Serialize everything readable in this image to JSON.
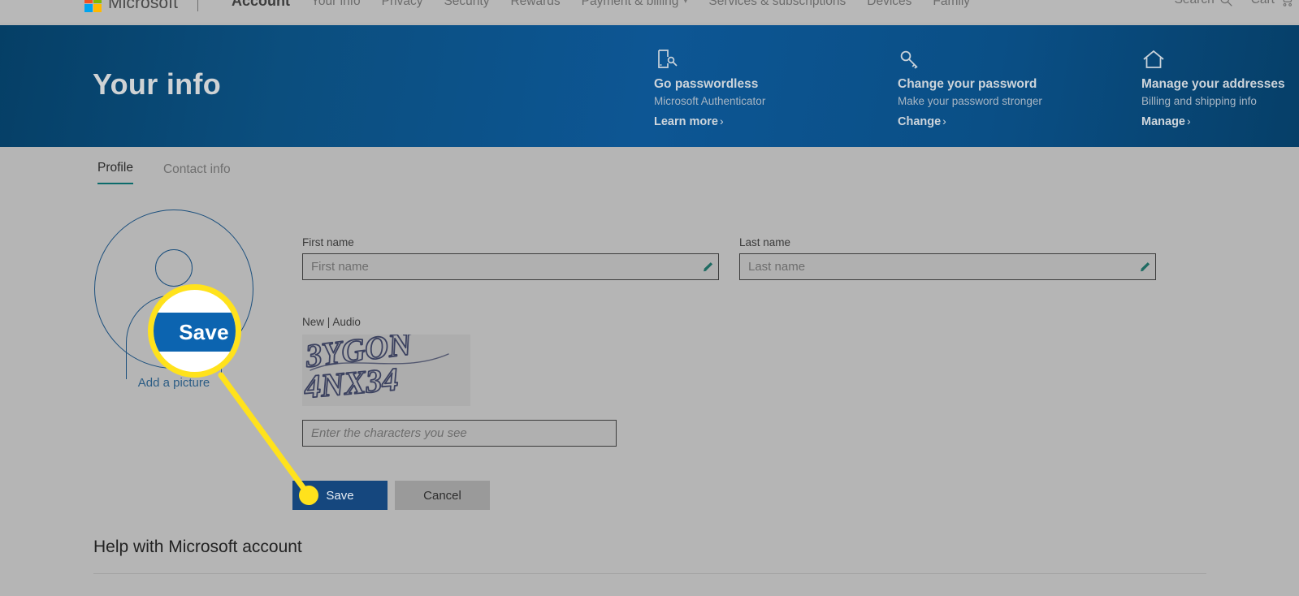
{
  "topnav": {
    "brand": "Microsoft",
    "logo_colors": [
      "#f25022",
      "#7fba00",
      "#00a4ef",
      "#ffb900"
    ],
    "links": [
      {
        "label": "Account",
        "bold": true,
        "caret": false
      },
      {
        "label": "Your info",
        "bold": false,
        "caret": false
      },
      {
        "label": "Privacy",
        "bold": false,
        "caret": false
      },
      {
        "label": "Security",
        "bold": false,
        "caret": false
      },
      {
        "label": "Rewards",
        "bold": false,
        "caret": false
      },
      {
        "label": "Payment & billing",
        "bold": false,
        "caret": true
      },
      {
        "label": "Services & subscriptions",
        "bold": false,
        "caret": false
      },
      {
        "label": "Devices",
        "bold": false,
        "caret": false
      },
      {
        "label": "Family",
        "bold": false,
        "caret": false
      }
    ],
    "search_label": "Search",
    "search_icon": "search-icon",
    "cart_label": "Cart",
    "cart_icon": "cart-icon"
  },
  "hero": {
    "title": "Your info",
    "background_color": "#0d5694",
    "cards": [
      {
        "icon": "passwordless-phone-key-icon",
        "heading": "Go passwordless",
        "subtext": "Microsoft Authenticator",
        "link": "Learn more",
        "chevron": "›"
      },
      {
        "icon": "key-icon",
        "heading": "Change your password",
        "subtext": "Make your password stronger",
        "link": "Change",
        "chevron": "›"
      },
      {
        "icon": "home-icon",
        "heading": "Manage your addresses",
        "subtext": "Billing and shipping info",
        "link": "Manage",
        "chevron": "›"
      }
    ]
  },
  "tabs": {
    "items": [
      {
        "label": "Profile",
        "active": true
      },
      {
        "label": "Contact info",
        "active": false
      }
    ],
    "active_underline_color": "#0b6b6b"
  },
  "profile": {
    "avatar_icon": "person-avatar-icon",
    "add_picture_label": "Add a picture",
    "first_name": {
      "label": "First name",
      "placeholder": "First name",
      "value": "",
      "icon": "pencil-edit-icon",
      "icon_color": "#1f6b62"
    },
    "last_name": {
      "label": "Last name",
      "placeholder": "Last name",
      "value": "",
      "icon": "pencil-edit-icon",
      "icon_color": "#1f6b62"
    },
    "captcha": {
      "new_label": "New",
      "separator": "|",
      "audio_label": "Audio",
      "challenge_text": "3YGON4NX34",
      "challenge_line1": "3YGON",
      "challenge_line2": "4NX34",
      "input_placeholder": "Enter the characters you see",
      "input_value": ""
    },
    "buttons": {
      "save": "Save",
      "cancel": "Cancel",
      "save_color": "#15477e",
      "cancel_color": "#9a9a9a"
    }
  },
  "help": {
    "title": "Help with Microsoft account"
  },
  "annotation": {
    "callout_color": "#ffe21c",
    "magnifier_label": "Save",
    "magnifier_button_color": "#0c64b0",
    "target": "save-button"
  }
}
